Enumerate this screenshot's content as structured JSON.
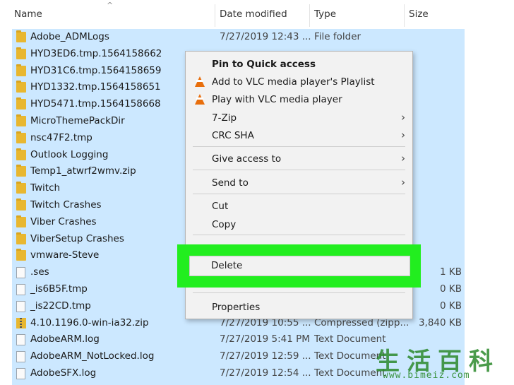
{
  "header": {
    "columns": {
      "name": "Name",
      "date_modified": "Date modified",
      "type": "Type",
      "size": "Size"
    },
    "sort_indicator": "^"
  },
  "files": [
    {
      "name": "Adobe_ADMLogs",
      "date": "7/27/2019 12:43 ...",
      "type": "File folder",
      "size": "",
      "icon": "folder-icon"
    },
    {
      "name": "HYD3ED6.tmp.1564158662",
      "date": "",
      "type": "",
      "size": "",
      "icon": "folder-icon"
    },
    {
      "name": "HYD31C6.tmp.1564158659",
      "date": "",
      "type": "",
      "size": "",
      "icon": "folder-icon"
    },
    {
      "name": "HYD1332.tmp.1564158651",
      "date": "",
      "type": "",
      "size": "",
      "icon": "folder-icon"
    },
    {
      "name": "HYD5471.tmp.1564158668",
      "date": "",
      "type": "",
      "size": "",
      "icon": "folder-icon"
    },
    {
      "name": "MicroThemePackDir",
      "date": "",
      "type": "",
      "size": "",
      "icon": "folder-icon"
    },
    {
      "name": "nsc47F2.tmp",
      "date": "",
      "type": "",
      "size": "",
      "icon": "folder-icon"
    },
    {
      "name": "Outlook Logging",
      "date": "",
      "type": "",
      "size": "",
      "icon": "folder-icon"
    },
    {
      "name": "Temp1_atwrf2wmv.zip",
      "date": "",
      "type": "",
      "size": "",
      "icon": "folder-icon"
    },
    {
      "name": "Twitch",
      "date": "",
      "type": "",
      "size": "",
      "icon": "folder-icon"
    },
    {
      "name": "Twitch Crashes",
      "date": "",
      "type": "",
      "size": "",
      "icon": "folder-icon"
    },
    {
      "name": "Viber Crashes",
      "date": "",
      "type": "",
      "size": "",
      "icon": "folder-icon"
    },
    {
      "name": "ViberSetup Crashes",
      "date": "",
      "type": "",
      "size": "",
      "icon": "folder-icon"
    },
    {
      "name": "vmware-Steve",
      "date": "",
      "type": "",
      "size": "",
      "icon": "folder-icon"
    },
    {
      "name": ".ses",
      "date": "",
      "type": "",
      "size": "1 KB",
      "icon": "file-icon"
    },
    {
      "name": "_is6B5F.tmp",
      "date": "",
      "type": "",
      "size": "0 KB",
      "icon": "file-icon"
    },
    {
      "name": "_is22CD.tmp",
      "date": "",
      "type": "",
      "size": "0 KB",
      "icon": "file-icon"
    },
    {
      "name": "4.10.1196.0-win-ia32.zip",
      "date": "7/27/2019 10:55 ...",
      "type": "Compressed (zipp...",
      "size": "3,840 KB",
      "icon": "zip-icon"
    },
    {
      "name": "AdobeARM.log",
      "date": "7/27/2019 5:41 PM",
      "type": "Text Document",
      "size": "",
      "icon": "file-icon"
    },
    {
      "name": "AdobeARM_NotLocked.log",
      "date": "7/27/2019 12:59 ...",
      "type": "Text Document",
      "size": "",
      "icon": "file-icon"
    },
    {
      "name": "AdobeSFX.log",
      "date": "7/27/2019 12:54 ...",
      "type": "Text Document",
      "size": "",
      "icon": "file-icon"
    }
  ],
  "context_menu": {
    "pin_to_quick_access": "Pin to Quick access",
    "add_to_vlc_playlist": "Add to VLC media player's Playlist",
    "play_with_vlc": "Play with VLC media player",
    "seven_zip": "7-Zip",
    "crc_sha": "CRC SHA",
    "give_access_to": "Give access to",
    "send_to": "Send to",
    "cut": "Cut",
    "copy": "Copy",
    "delete": "Delete",
    "properties": "Properties",
    "submenu_arrow": "›",
    "vlc_icon": "vlc-cone-icon"
  },
  "watermark": {
    "chinese": "生活百科",
    "url": "www.bimeiz.com"
  },
  "colors": {
    "selection": "#cce8ff",
    "highlight": "#22ee1f",
    "folder": "#e8b730",
    "vlc": "#e86e0c"
  }
}
